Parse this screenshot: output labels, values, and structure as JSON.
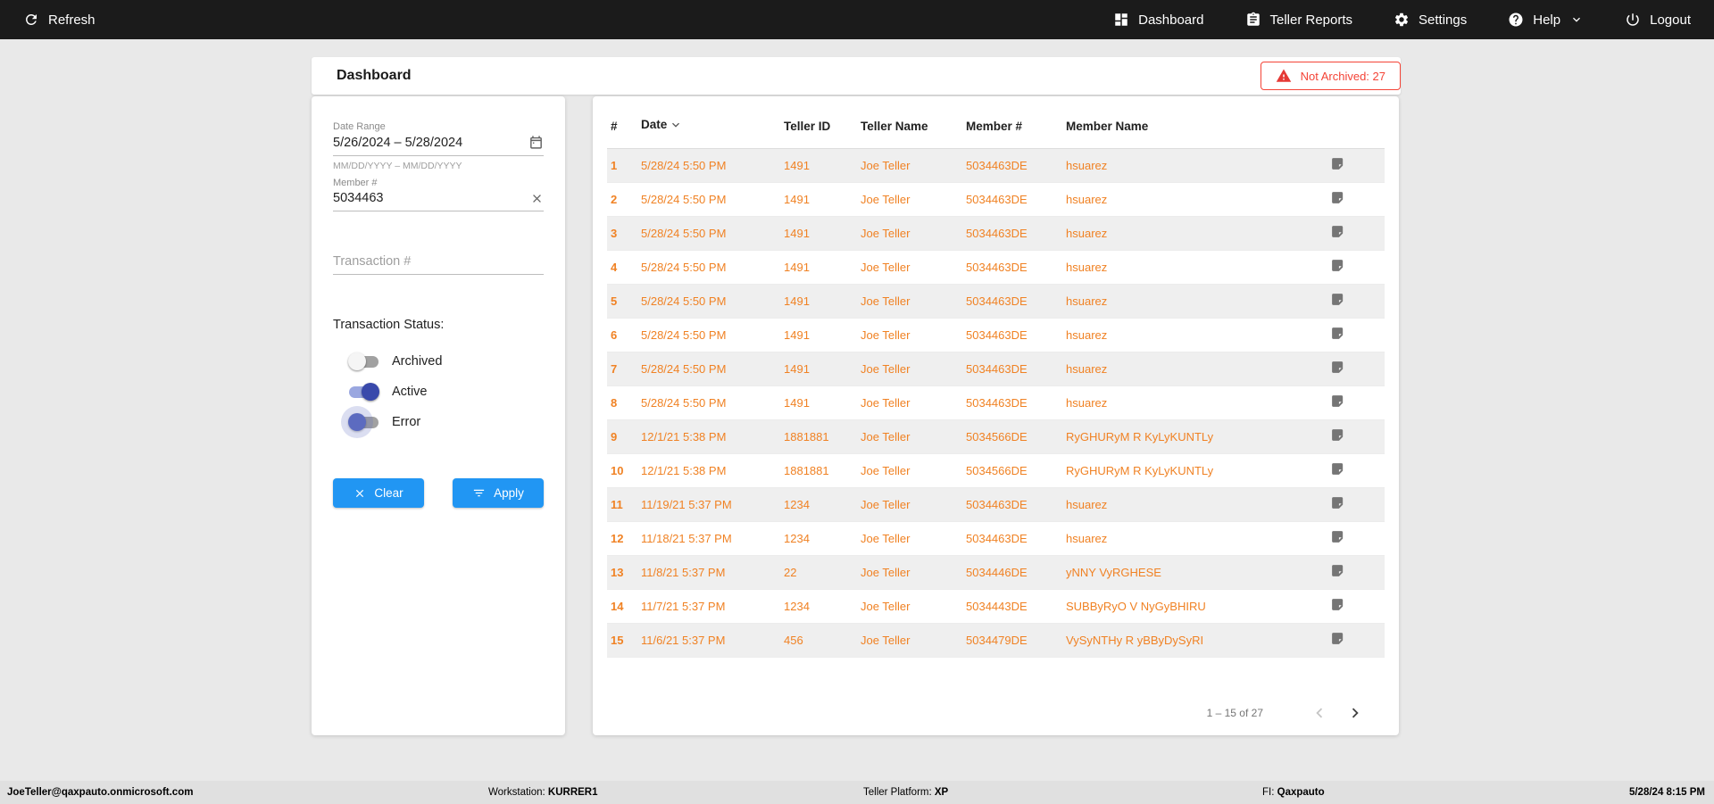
{
  "topbar": {
    "refresh_label": "Refresh",
    "refresh_icon": "refresh-icon",
    "items": [
      {
        "label": "Dashboard",
        "icon": "dashboard-icon"
      },
      {
        "label": "Teller Reports",
        "icon": "clipboard-icon"
      },
      {
        "label": "Settings",
        "icon": "gear-icon"
      },
      {
        "label": "Help",
        "icon": "help-icon",
        "chevron_icon": "chevron-down-icon"
      },
      {
        "label": "Logout",
        "icon": "power-icon"
      }
    ]
  },
  "header": {
    "title": "Dashboard",
    "badge": "Not Archived: 27",
    "badge_icon": "warning-icon"
  },
  "filters": {
    "date_range": {
      "label": "Date Range",
      "value": "5/26/2024 – 5/28/2024",
      "hint": "MM/DD/YYYY – MM/DD/YYYY",
      "icon": "calendar-icon"
    },
    "member": {
      "label": "Member #",
      "value": "5034463",
      "clear_icon": "close-icon"
    },
    "transaction": {
      "placeholder": "Transaction #"
    },
    "status_label": "Transaction Status:",
    "toggles": [
      {
        "label": "Archived",
        "state": "off"
      },
      {
        "label": "Active",
        "state": "on"
      },
      {
        "label": "Error",
        "state": "off-focus"
      }
    ],
    "clear_label": "Clear",
    "apply_label": "Apply"
  },
  "table": {
    "columns": [
      "#",
      "Date",
      "Teller ID",
      "Teller Name",
      "Member #",
      "Member Name"
    ],
    "sort_column": "Date",
    "sort_direction": "desc",
    "row_icon": "note-icon",
    "rows": [
      {
        "num": "1",
        "date": "5/28/24 5:50 PM",
        "teller_id": "1491",
        "teller_name": "Joe Teller",
        "member_number": "5034463DE",
        "member_name": "hsuarez"
      },
      {
        "num": "2",
        "date": "5/28/24 5:50 PM",
        "teller_id": "1491",
        "teller_name": "Joe Teller",
        "member_number": "5034463DE",
        "member_name": "hsuarez"
      },
      {
        "num": "3",
        "date": "5/28/24 5:50 PM",
        "teller_id": "1491",
        "teller_name": "Joe Teller",
        "member_number": "5034463DE",
        "member_name": "hsuarez"
      },
      {
        "num": "4",
        "date": "5/28/24 5:50 PM",
        "teller_id": "1491",
        "teller_name": "Joe Teller",
        "member_number": "5034463DE",
        "member_name": "hsuarez"
      },
      {
        "num": "5",
        "date": "5/28/24 5:50 PM",
        "teller_id": "1491",
        "teller_name": "Joe Teller",
        "member_number": "5034463DE",
        "member_name": "hsuarez"
      },
      {
        "num": "6",
        "date": "5/28/24 5:50 PM",
        "teller_id": "1491",
        "teller_name": "Joe Teller",
        "member_number": "5034463DE",
        "member_name": "hsuarez"
      },
      {
        "num": "7",
        "date": "5/28/24 5:50 PM",
        "teller_id": "1491",
        "teller_name": "Joe Teller",
        "member_number": "5034463DE",
        "member_name": "hsuarez"
      },
      {
        "num": "8",
        "date": "5/28/24 5:50 PM",
        "teller_id": "1491",
        "teller_name": "Joe Teller",
        "member_number": "5034463DE",
        "member_name": "hsuarez"
      },
      {
        "num": "9",
        "date": "12/1/21 5:38 PM",
        "teller_id": "1881881",
        "teller_name": "Joe Teller",
        "member_number": "5034566DE",
        "member_name": "RyGHURyM R KyLyKUNTLy"
      },
      {
        "num": "10",
        "date": "12/1/21 5:38 PM",
        "teller_id": "1881881",
        "teller_name": "Joe Teller",
        "member_number": "5034566DE",
        "member_name": "RyGHURyM R KyLyKUNTLy"
      },
      {
        "num": "11",
        "date": "11/19/21 5:37 PM",
        "teller_id": "1234",
        "teller_name": "Joe Teller",
        "member_number": "5034463DE",
        "member_name": "hsuarez"
      },
      {
        "num": "12",
        "date": "11/18/21 5:37 PM",
        "teller_id": "1234",
        "teller_name": "Joe Teller",
        "member_number": "5034463DE",
        "member_name": "hsuarez"
      },
      {
        "num": "13",
        "date": "11/8/21 5:37 PM",
        "teller_id": "22",
        "teller_name": "Joe Teller",
        "member_number": "5034446DE",
        "member_name": "yNNY VyRGHESE"
      },
      {
        "num": "14",
        "date": "11/7/21 5:37 PM",
        "teller_id": "1234",
        "teller_name": "Joe Teller",
        "member_number": "5034443DE",
        "member_name": "SUBByRyO V NyGyBHIRU"
      },
      {
        "num": "15",
        "date": "11/6/21 5:37 PM",
        "teller_id": "456",
        "teller_name": "Joe Teller",
        "member_number": "5034479DE",
        "member_name": "VySyNTHy R yBByDySyRI"
      }
    ],
    "pagination": {
      "range_label": "1 – 15 of 27"
    }
  },
  "footer": {
    "user": "JoeTeller@qaxpauto.onmicrosoft.com",
    "workstation_label": "Workstation:",
    "workstation_value": "KURRER1",
    "platform_label": "Teller Platform:",
    "platform_value": "XP",
    "fi_label": "FI:",
    "fi_value": "Qaxpauto",
    "datetime": "5/28/24 8:15 PM"
  },
  "colors": {
    "accent_orange": "#F08224",
    "primary_blue": "#2196F3",
    "alert_red": "#F44336",
    "toggle_active": "#3949AB",
    "topbar_bg": "#1B1B1B"
  }
}
